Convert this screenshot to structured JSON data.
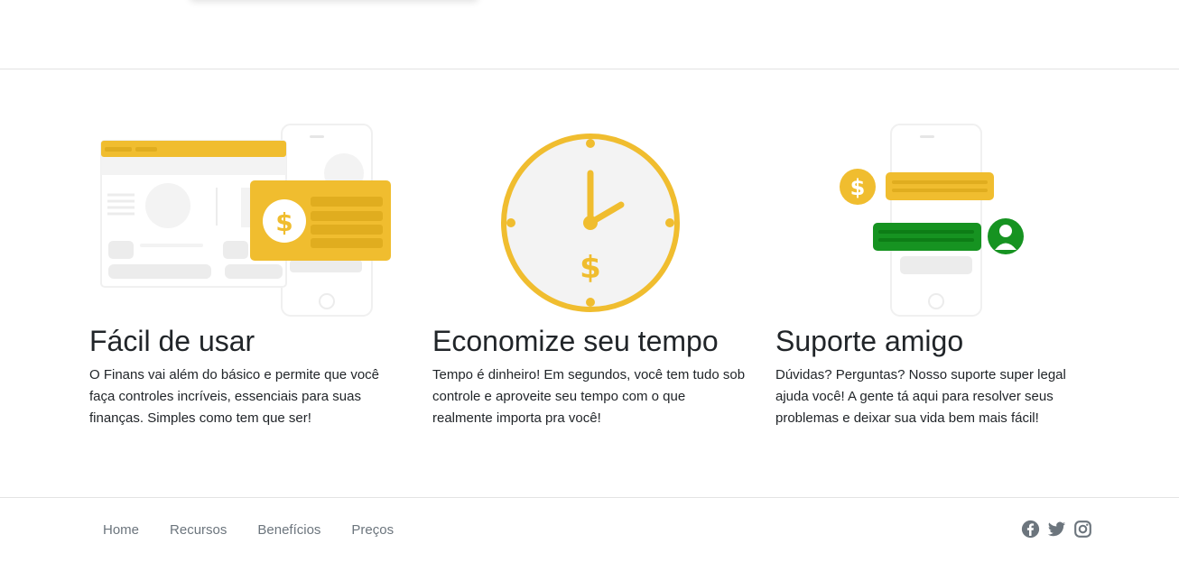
{
  "colors": {
    "accent": "#f0bd2f",
    "accent_dark": "#e0ad1f",
    "green": "#169321",
    "muted_gray": "#6c757d",
    "light_gray": "#f3f3f3",
    "divider": "#e3e3e3"
  },
  "features": [
    {
      "icon": "dashboard-phone-illustration",
      "title": "Fácil de usar",
      "description": "O Finans vai além do básico e permite que você faça controles incríveis, essenciais para suas finanças. Simples como tem que ser!"
    },
    {
      "icon": "clock-money-illustration",
      "title": "Economize seu tempo",
      "description": "Tempo é dinheiro! Em segundos, você tem tudo sob controle e aproveite seu tempo com o que realmente importa pra você!"
    },
    {
      "icon": "chat-support-illustration",
      "title": "Suporte amigo",
      "description": "Dúvidas? Perguntas? Nosso suporte super legal ajuda você! A gente tá aqui para resolver seus problemas e deixar sua vida bem mais fácil!"
    }
  ],
  "footer": {
    "nav": [
      "Home",
      "Recursos",
      "Benefícios",
      "Preços"
    ],
    "social_icons": [
      "facebook-icon",
      "twitter-icon",
      "instagram-icon"
    ]
  }
}
